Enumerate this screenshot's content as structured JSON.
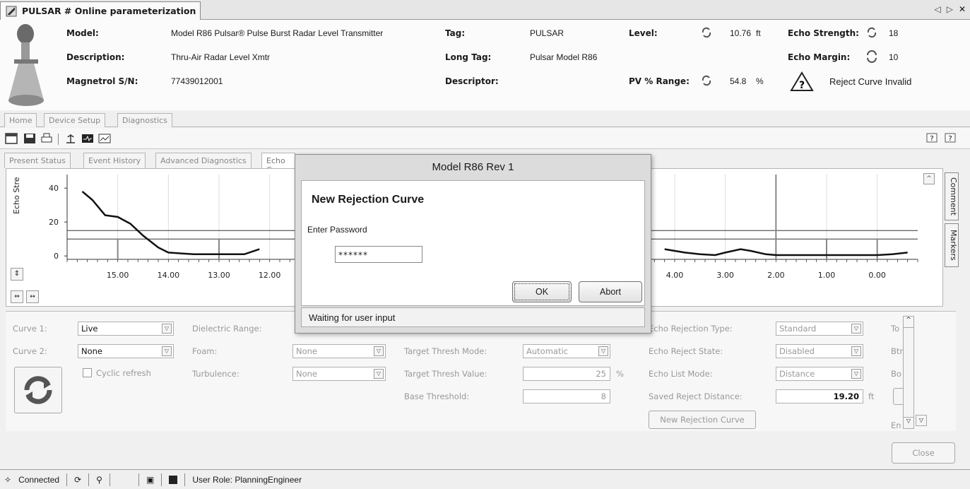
{
  "window": {
    "title": "PULSAR # Online parameterization"
  },
  "header": {
    "model_label": "Model:",
    "model_value": "Model R86 Pulsar® Pulse Burst Radar Level Transmitter",
    "description_label": "Description:",
    "description_value": "Thru-Air Radar Level Xmtr",
    "sn_label": "Magnetrol S/N:",
    "sn_value": "77439012001",
    "tag_label": "Tag:",
    "tag_value": "PULSAR",
    "longtag_label": "Long Tag:",
    "longtag_value": "Pulsar Model R86",
    "descriptor_label": "Descriptor:",
    "descriptor_value": "",
    "level_label": "Level:",
    "level_value": "10.76",
    "level_unit": "ft",
    "pvrange_label": "PV % Range:",
    "pvrange_value": "54.8",
    "pvrange_unit": "%",
    "echo_strength_label": "Echo Strength:",
    "echo_strength_value": "18",
    "echo_margin_label": "Echo Margin:",
    "echo_margin_value": "10",
    "warning_text": "Reject Curve Invalid"
  },
  "menu_tabs": [
    "Home",
    "Device Setup",
    "Diagnostics"
  ],
  "sub_tabs": [
    "Present Status",
    "Event History",
    "Advanced Diagnostics",
    "Echo C"
  ],
  "side_tabs": [
    "Comment",
    "Markers"
  ],
  "chart_data": {
    "type": "line",
    "ylabel": "Echo Stre",
    "yticks": [
      "40",
      "20",
      "0"
    ],
    "xticks": [
      "15.00",
      "14.00",
      "13.00",
      "12.00",
      "4.00",
      "3.00",
      "2.00",
      "1.00",
      "0.00"
    ],
    "series": [
      {
        "x": [
          15.7,
          15.5,
          15.25,
          15.0,
          14.75,
          14.5,
          14.2,
          14.0,
          13.5,
          13.0,
          12.5,
          12.2
        ],
        "y": [
          38,
          33,
          24,
          23,
          19,
          12,
          5,
          2,
          1,
          1,
          1,
          4
        ]
      },
      {
        "x": [
          4.2,
          3.8,
          3.5,
          3.2,
          3.0,
          2.7,
          2.5,
          2.2,
          2.0,
          1.5,
          1.0,
          0.5,
          0.0,
          -0.3,
          -0.6
        ],
        "y": [
          4,
          2,
          1,
          0.5,
          2,
          4,
          3,
          1,
          0.5,
          0.5,
          0.5,
          0.5,
          0.5,
          1,
          2
        ]
      }
    ],
    "thresholds": [
      15,
      10
    ],
    "xlim": [
      16.0,
      -0.8
    ],
    "ylim": [
      -2,
      48
    ]
  },
  "settings": {
    "curve1_label": "Curve 1:",
    "curve1_value": "Live",
    "curve2_label": "Curve 2:",
    "curve2_value": "None",
    "cyclic_label": "Cyclic refresh",
    "dielectric_label": "Dielectric Range:",
    "foam_label": "Foam:",
    "foam_value": "None",
    "turbulence_label": "Turbulence:",
    "turbulence_value": "None",
    "tt_mode_label": "Target Thresh Mode:",
    "tt_mode_value": "Automatic",
    "tt_value_label": "Target Thresh Value:",
    "tt_value": "25",
    "tt_unit": "%",
    "base_label": "Base Threshold:",
    "base_value": "8",
    "ert_label": "Echo Rejection Type:",
    "ert_value": "Standard",
    "ers_label": "Echo Reject State:",
    "ers_value": "Disabled",
    "elm_label": "Echo List Mode:",
    "elm_value": "Distance",
    "srd_label": "Saved Reject Distance:",
    "srd_value": "19.20",
    "srd_unit": "ft",
    "nrc_button": "New Rejection Curve",
    "trunc1": "To",
    "trunc2": "Btr",
    "trunc3": "Bo",
    "trunc4": "En"
  },
  "close_button": "Close",
  "status": {
    "connected": "Connected",
    "role": "User Role: PlanningEngineer"
  },
  "modal": {
    "title": "Model R86 Rev 1",
    "heading": "New Rejection Curve",
    "prompt": "Enter Password",
    "password": "******",
    "ok": "OK",
    "abort": "Abort",
    "status": "Waiting for user input"
  }
}
